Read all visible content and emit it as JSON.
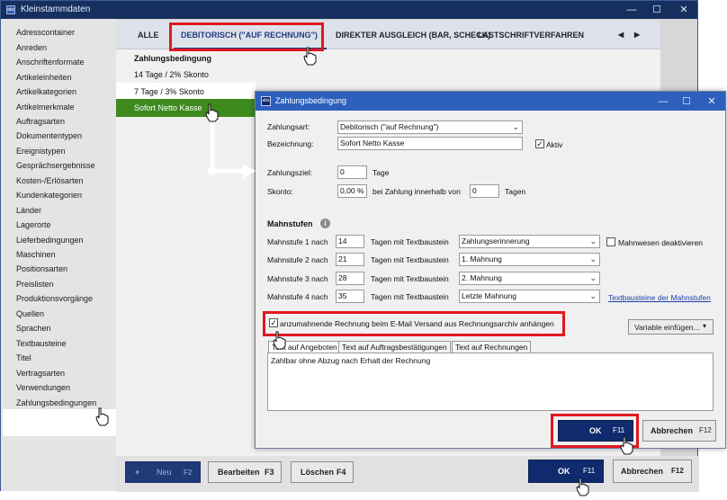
{
  "main_window": {
    "title": "Kleinstammdaten",
    "controls": [
      "—",
      "☐",
      "✕"
    ]
  },
  "sidebar": {
    "items": [
      "Adresscontainer",
      "Anreden",
      "Anschriftenformate",
      "Artikeleinheiten",
      "Artikelkategorien",
      "Artikelmerkmale",
      "Auftragsarten",
      "Dokumententypen",
      "Ereignistypen",
      "Gesprächsergebnisse",
      "Kosten-/Erlösarten",
      "Kundenkategorien",
      "Länder",
      "Lagerorte",
      "Lieferbedingungen",
      "Maschinen",
      "Positionsarten",
      "Preislisten",
      "Produktionsvorgänge",
      "Quellen",
      "Sprachen",
      "Textbausteine",
      "Titel",
      "Vertragsarten",
      "Verwendungen",
      "Zahlungsbedingungen"
    ],
    "selected": "Zahlungsbedingungen"
  },
  "tabs": {
    "items": [
      "ALLE",
      "DEBITORISCH (\"AUF RECHNUNG\")",
      "DIREKTER AUSGLEICH (BAR, SCHECK)",
      "LASTSCHRIFTVERFAHREN"
    ],
    "active": "DEBITORISCH (\"AUF RECHNUNG\")",
    "prev": "◀",
    "next": "▶"
  },
  "list": {
    "header": "Zahlungsbedingung",
    "rows": [
      "14 Tage / 2% Skonto",
      "7 Tage / 3% Skonto",
      "Sofort Netto Kasse"
    ],
    "selected": "Sofort Netto Kasse"
  },
  "bottom_bar": {
    "new_plus": "+",
    "new_label": "Neu",
    "new_key": "F2",
    "edit_label": "Bearbeiten",
    "edit_key": "F3",
    "delete_label": "Löschen",
    "delete_key": "F4",
    "ok_label": "OK",
    "ok_key": "F11",
    "cancel_label": "Abbrechen",
    "cancel_key": "F12"
  },
  "dialog": {
    "title": "Zahlungsbedingung",
    "controls": [
      "—",
      "☐",
      "✕"
    ],
    "zahlungsart_label": "Zahlungsart:",
    "zahlungsart_value": "Debitorisch (\"auf Rechnung\")",
    "bezeichnung_label": "Bezeichnung:",
    "bezeichnung_value": "Sofort Netto Kasse",
    "aktiv_label": "Aktiv",
    "aktiv_checked": true,
    "zahlungsziel_label": "Zahlungsziel:",
    "zahlungsziel_value": "0",
    "tage_label": "Tage",
    "skonto_label": "Skonto:",
    "skonto_value": "0,00 %",
    "skonto_mid_label": "bei Zahlung innerhalb von",
    "skonto_days_value": "0",
    "skonto_tage_label": "Tagen",
    "mahnstufen_label": "Mahnstufen",
    "info_icon": "i",
    "mahnstufen": [
      {
        "label": "Mahnstufe 1 nach",
        "days": "14",
        "text_label": "Tagen mit Textbaustein",
        "baustein": "Zahlungserinnerung"
      },
      {
        "label": "Mahnstufe 2 nach",
        "days": "21",
        "text_label": "Tagen mit Textbaustein",
        "baustein": "1. Mahnung"
      },
      {
        "label": "Mahnstufe 3 nach",
        "days": "28",
        "text_label": "Tagen mit Textbaustein",
        "baustein": "2. Mahnung"
      },
      {
        "label": "Mahnstufe 4 nach",
        "days": "35",
        "text_label": "Tagen mit Textbaustein",
        "baustein": "Letzte Mahnung"
      }
    ],
    "mahnwesen_label": "Mahnwesen deaktivieren",
    "mahnwesen_checked": false,
    "textbausteine_link": "Textbausteine der Mahnstufen",
    "attach_label": "anzumahnende Rechnung beim E-Mail Versand aus Rechnungsarchiv anhängen",
    "attach_checked": true,
    "variable_button": "Variable einfügen...",
    "subtabs": [
      "Text auf Angeboten",
      "Text auf Auftragsbestätigungen",
      "Text auf Rechnungen"
    ],
    "subtab_active": "Text auf Angeboten",
    "text_value": "Zahlbar ohne Abzug nach Erhalt der Rechnung",
    "ok_label": "OK",
    "ok_key": "F11",
    "cancel_label": "Abbrechen",
    "cancel_key": "F12"
  },
  "colors": {
    "annotation_red": "#e2161f",
    "selection_green": "#3d8a1f",
    "dark_button": "#0f2b6d",
    "titlebar": "#15305f"
  }
}
